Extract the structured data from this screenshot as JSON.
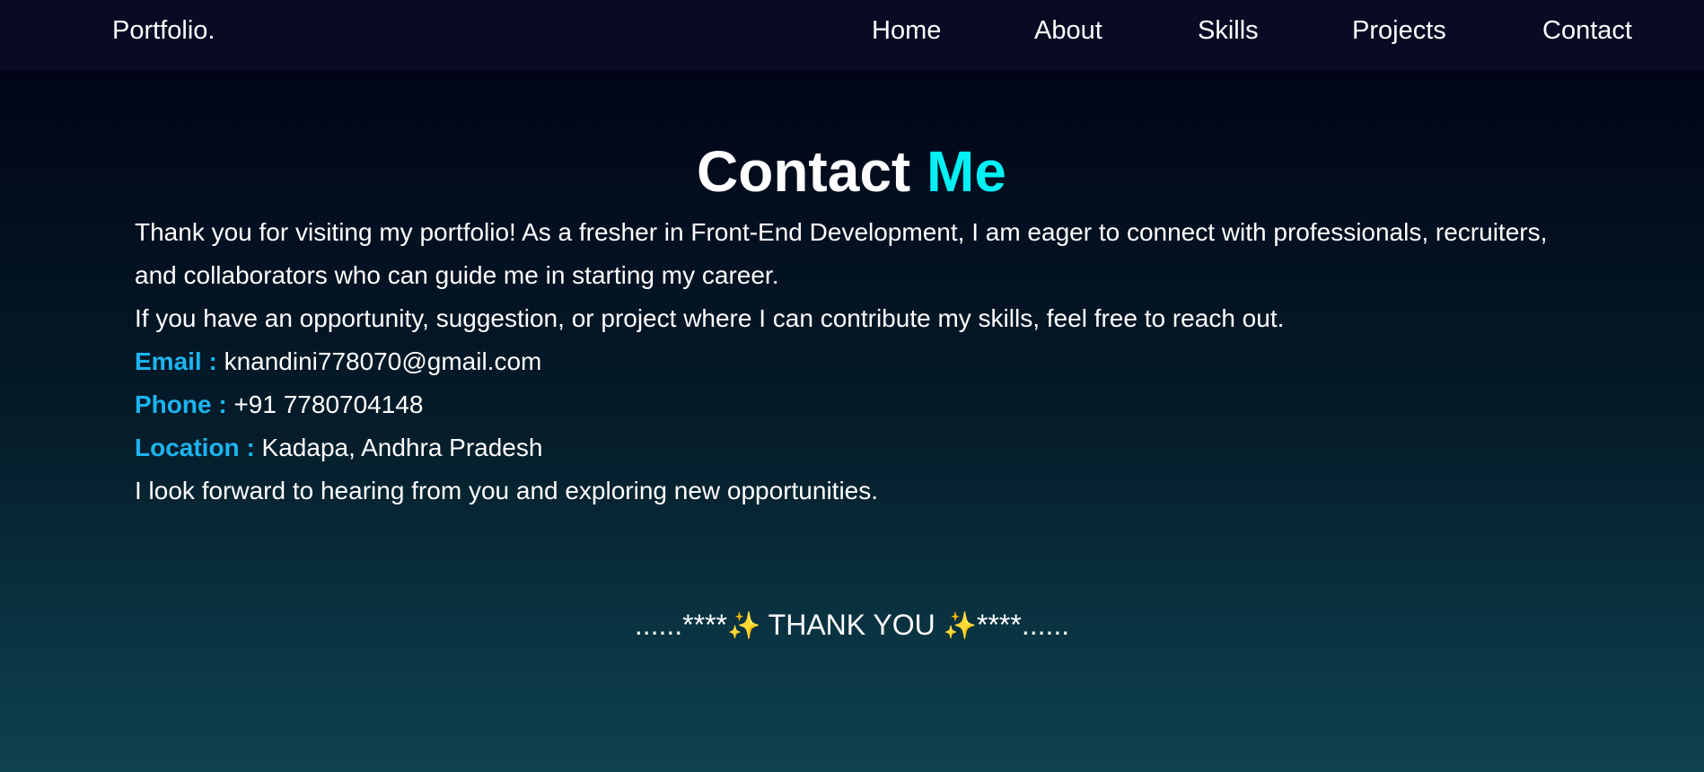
{
  "nav": {
    "brand": "Portfolio.",
    "links": [
      "Home",
      "About",
      "Skills",
      "Projects",
      "Contact"
    ]
  },
  "contact": {
    "title_main": "Contact",
    "title_accent": "Me",
    "intro": "Thank you for visiting my portfolio! As a fresher in Front-End Development, I am eager to connect with professionals, recruiters, and collaborators who can guide me in starting my career.",
    "invite": "If you have an opportunity, suggestion, or project where I can contribute my skills, feel free to reach out.",
    "email_label": "Email :",
    "email_value": "knandini778070@gmail.com",
    "phone_label": "Phone :",
    "phone_value": "+91 7780704148",
    "location_label": "Location :",
    "location_value": "Kadapa, Andhra Pradesh",
    "closing": "I look forward to hearing from you and exploring new opportunities."
  },
  "footer": {
    "left_deco": "......****",
    "sparkle": "✨",
    "thanks": "THANK YOU",
    "right_deco": "****......"
  },
  "colors": {
    "accent_cyan": "#00f0f5",
    "label_blue": "#1cb4f0",
    "navbar_bg": "#090a24"
  }
}
